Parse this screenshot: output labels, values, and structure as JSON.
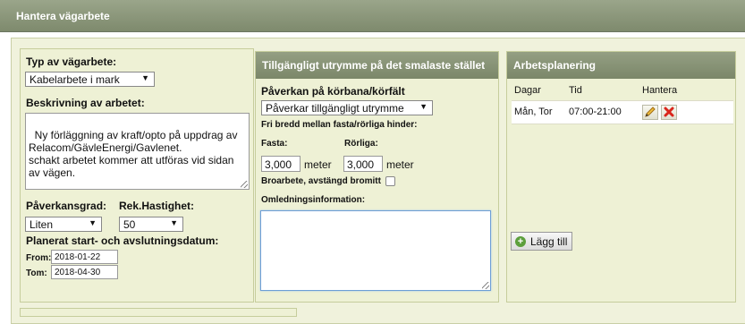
{
  "header": {
    "title": "Hantera vägarbete"
  },
  "left": {
    "type_label": "Typ av vägarbete:",
    "type_value": "Kabelarbete i mark",
    "desc_label": "Beskrivning av arbetet:",
    "desc_value": "Ny förläggning av kraft/opto på uppdrag av Relacom/GävleEnergi/Gavlenet.\nschakt arbetet kommer att utföras vid sidan av vägen.",
    "impact_label": "Påverkansgrad:",
    "impact_value": "Liten",
    "speed_label": "Rek.Hastighet:",
    "speed_value": "50",
    "period_label": "Planerat start- och avslutningsdatum:",
    "from_label": "From:",
    "from_value": "2018-01-22",
    "to_label": "Tom:",
    "to_value": "2018-04-30"
  },
  "middle": {
    "title": "Tillgängligt utrymme på det smalaste stället",
    "impact_label": "Påverkan på körbana/körfält",
    "impact_value": "Påverkar tillgängligt utrymme",
    "width_label": "Fri bredd mellan fasta/rörliga hinder:",
    "fixed_label": "Fasta:",
    "fixed_value": "3,000",
    "fixed_unit": "meter",
    "mobile_label": "Rörliga:",
    "mobile_value": "3,000",
    "mobile_unit": "meter",
    "bridge_label": "Broarbete, avstängd bromitt",
    "bridge_checked": false,
    "detour_label": "Omledningsinformation:",
    "detour_value": ""
  },
  "right": {
    "title": "Arbetsplanering",
    "columns": [
      "Dagar",
      "Tid",
      "Hantera"
    ],
    "rows": [
      {
        "days": "Mån, Tor",
        "time": "07:00-21:00"
      }
    ],
    "edit_icon": "pencil-icon",
    "delete_icon": "delete-x-icon",
    "add_label": "Lägg till",
    "add_icon": "plus-circle-icon",
    "accent_color": "#5c9f3c",
    "delete_color": "#d9261c"
  }
}
